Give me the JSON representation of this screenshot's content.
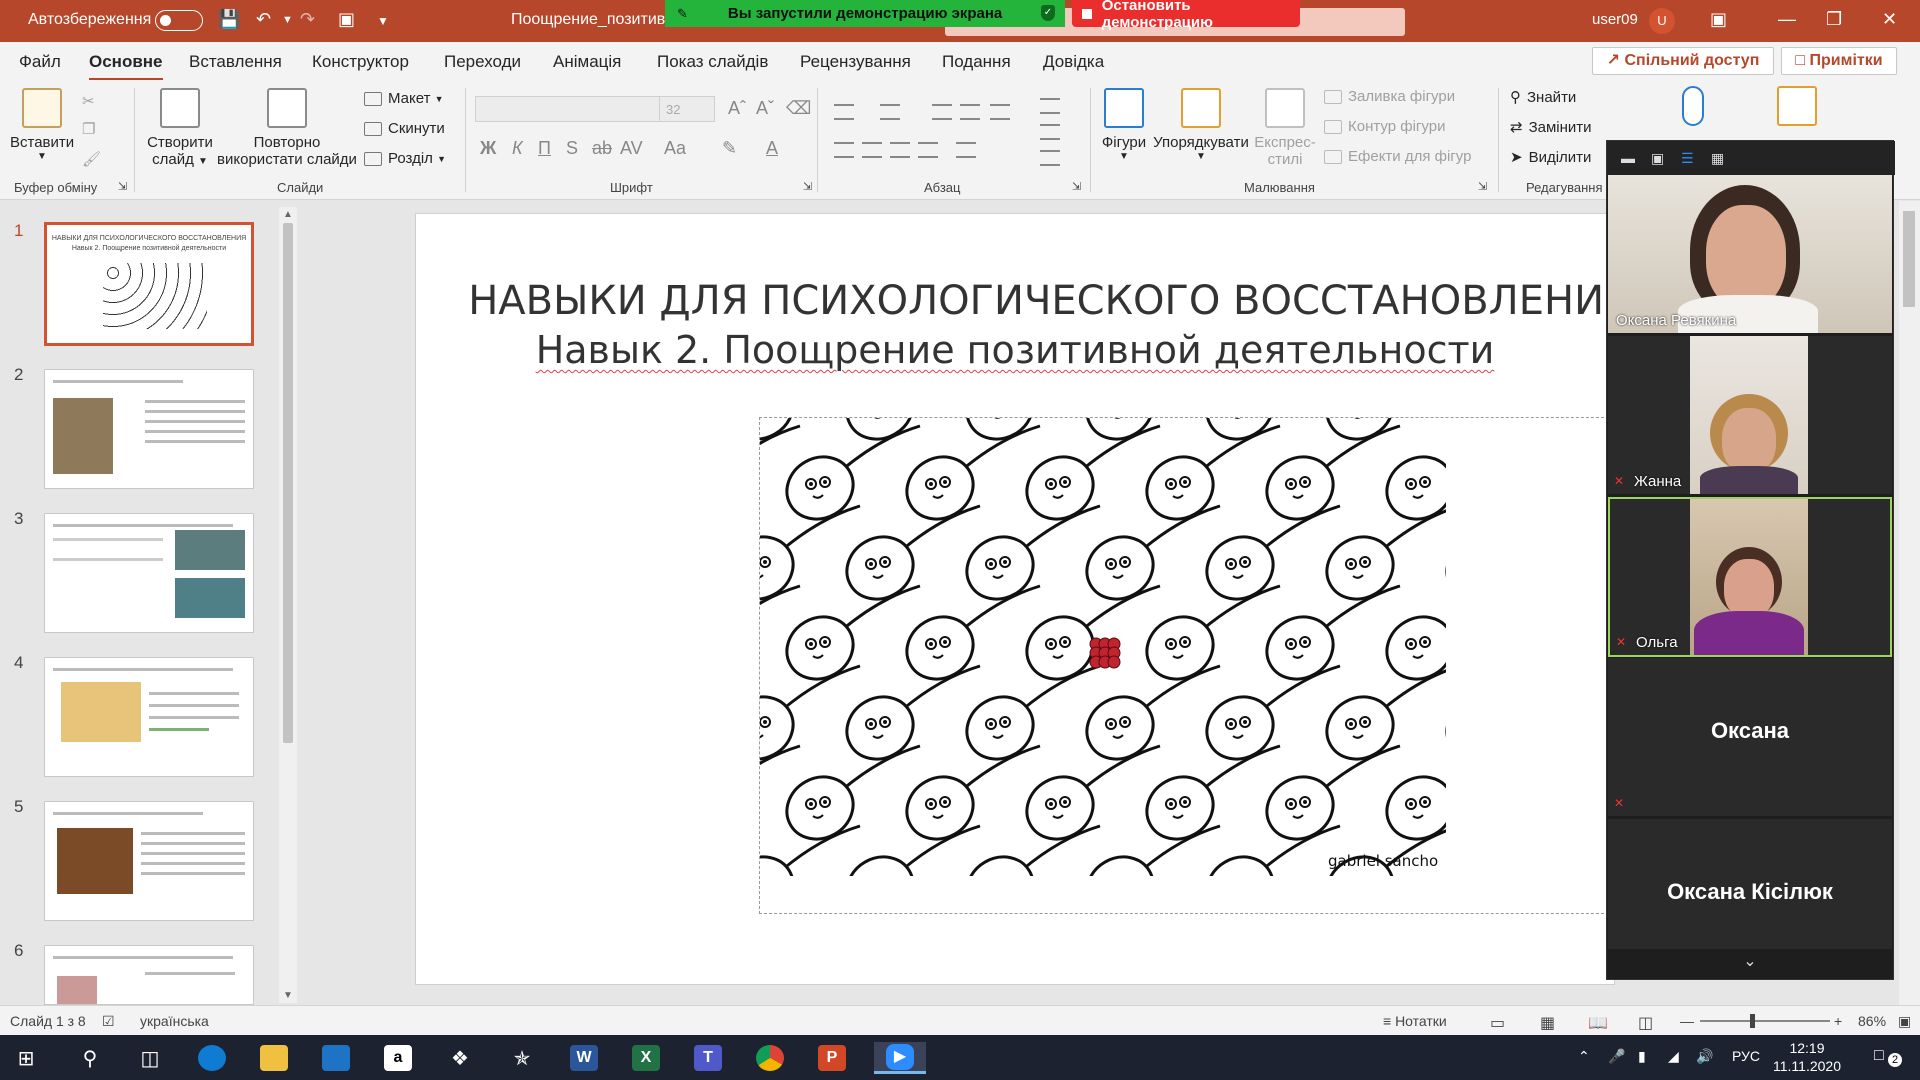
{
  "titlebar": {
    "autosave_label": "Автозбереження",
    "doc_title": "Поощрение_позитив",
    "user": "user09",
    "user_initial": "U"
  },
  "share_banner": {
    "status": "Вы запустили демонстрацию экрана",
    "stop": "Остановить демонстрацию"
  },
  "tabs": [
    "Файл",
    "Основне",
    "Вставлення",
    "Конструктор",
    "Переходи",
    "Анімація",
    "Показ слайдів",
    "Рецензування",
    "Подання",
    "Довідка"
  ],
  "tabs_share": "Спільний доступ",
  "tabs_notes": "Примітки",
  "ribbon": {
    "paste": "Вставити",
    "clipboard_group": "Буфер обміну",
    "new_slide_1": "Створити",
    "new_slide_2": "слайд",
    "reuse_1": "Повторно",
    "reuse_2": "використати слайди",
    "layout": "Макет",
    "reset": "Скинути",
    "section": "Розділ",
    "slides_group": "Слайди",
    "font_size": "32",
    "font_group": "Шрифт",
    "paragraph_group": "Абзац",
    "shapes": "Фігури",
    "arrange": "Упорядкувати",
    "quick_1": "Експрес-",
    "quick_2": "стилі",
    "fill": "Заливка фігури",
    "outline": "Контур фігури",
    "effects": "Ефекти для фігур",
    "drawing_group": "Малювання",
    "find": "Знайти",
    "replace": "Замінити",
    "select": "Виділити",
    "editing_group": "Редагування"
  },
  "thumbnails": [
    {
      "num": "1",
      "title": "НАВЫКИ ДЛЯ ПСИХОЛОГИЧЕСКОГО ВОССТАНОВЛЕНИЯ",
      "subtitle": "Навык 2. Поощрение позитивной деятельности"
    },
    {
      "num": "2"
    },
    {
      "num": "3"
    },
    {
      "num": "4"
    },
    {
      "num": "5"
    },
    {
      "num": "6"
    }
  ],
  "slide": {
    "title": "НАВЫКИ ДЛЯ ПСИХОЛОГИЧЕСКОГО ВОССТАНОВЛЕНИЯ",
    "subtitle": "Навык 2. Поощрение позитивной деятельности",
    "signature": "gabriel sancho"
  },
  "zoom": {
    "participants": [
      {
        "name": "Оксана Ревякина",
        "video": true
      },
      {
        "name": "Жанна",
        "video": true,
        "muted": true
      },
      {
        "name": "Ольга",
        "video": true,
        "muted": true,
        "active": true
      },
      {
        "name": "Оксана",
        "video": false,
        "muted": true
      },
      {
        "name": "Оксана Кісілюк",
        "video": false
      }
    ]
  },
  "statusbar": {
    "slide_info": "Слайд 1 з 8",
    "language": "українська",
    "notes": "Нотатки",
    "zoom": "86%"
  },
  "taskbar": {
    "lang": "РУС",
    "time": "12:19",
    "date": "11.11.2020",
    "notifications": "2"
  },
  "colors": {
    "accent": "#b7472a",
    "share_green": "#25b43b",
    "share_red": "#ea2d2d",
    "active_speaker": "#9bd65a"
  }
}
